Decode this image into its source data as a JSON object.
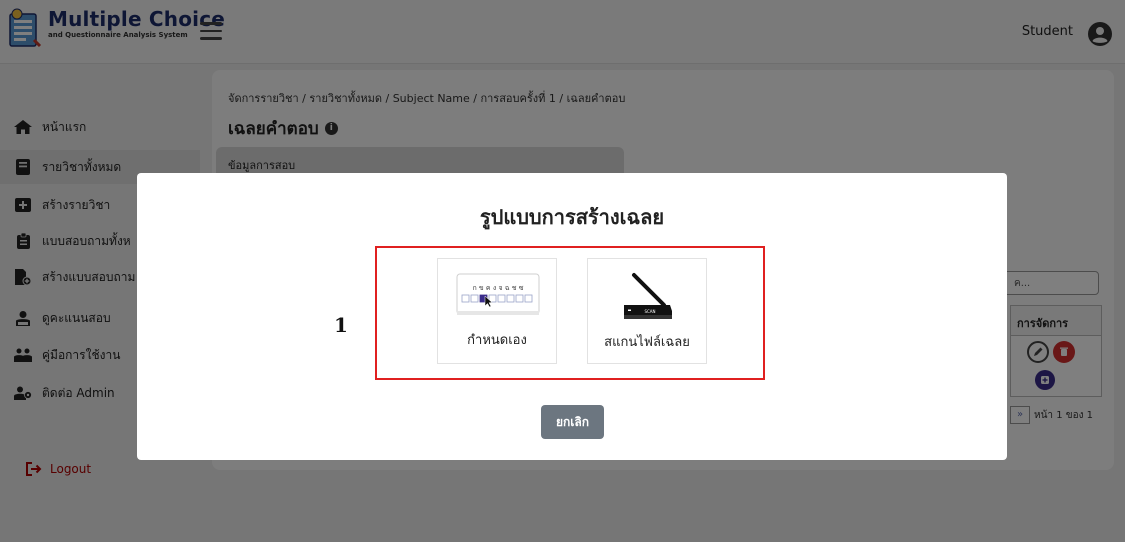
{
  "header": {
    "brand_title": "Multiple Choice",
    "brand_subtitle": "and Questionnaire Analysis System",
    "user_name": "Student"
  },
  "sidebar": {
    "items": [
      {
        "label": "หน้าแรก",
        "icon": "home-icon"
      },
      {
        "label": "รายวิชาทั้งหมด",
        "icon": "book-icon"
      },
      {
        "label": "สร้างรายวิชา",
        "icon": "add-icon"
      },
      {
        "label": "แบบสอบถามทั้งห",
        "icon": "clipboard-icon"
      },
      {
        "label": "สร้างแบบสอบถาม",
        "icon": "file-add-icon"
      },
      {
        "label": "ดูคะแนนสอบ",
        "icon": "scores-icon"
      },
      {
        "label": "คู่มือการใช้งาน",
        "icon": "manual-icon"
      },
      {
        "label": "ติดต่อ Admin",
        "icon": "contact-icon"
      }
    ],
    "logout_label": "Logout"
  },
  "main": {
    "breadcrumb": "จัดการรายวิชา / รายวิชาทั้งหมด / Subject Name / การสอบครั้งที่ 1 / เฉลยคำตอบ",
    "page_title": "เฉลยคำตอบ",
    "exam_info_label": "ข้อมูลการสอบ",
    "search_placeholder": "ค...",
    "table_header_actions": "การจัดการ",
    "pager_text": "หน้า 1 ของ 1",
    "pager_next": "»"
  },
  "modal": {
    "title": "รูปแบบการสร้างเฉลย",
    "step_number": "1",
    "options": [
      {
        "label": "กำหนดเอง",
        "icon": "manual-entry-icon",
        "letters": "ก ข ค ง จ ฉ ช ซ"
      },
      {
        "label": "สแกนไฟล์เฉลย",
        "icon": "scanner-icon",
        "scan_text": "SCAN"
      }
    ],
    "cancel_label": "ยกเลิก"
  },
  "colors": {
    "accent_red": "#e02020",
    "edit_button": "#444444",
    "delete_button": "#d32f2f",
    "add_button": "#3a2c8a",
    "cancel_button": "#6c7680",
    "brand_navy": "#1d2c6b"
  }
}
